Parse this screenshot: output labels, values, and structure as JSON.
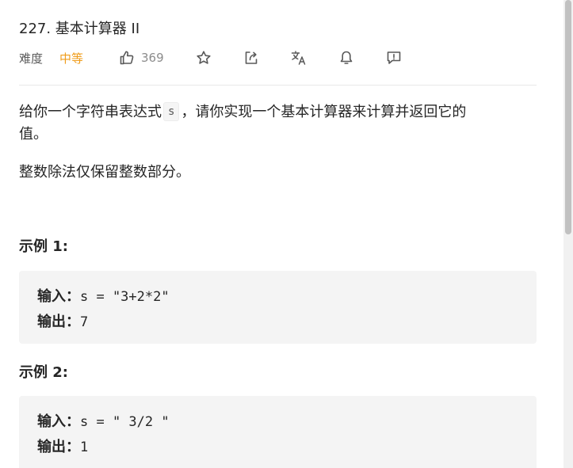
{
  "problem": {
    "title": "227. 基本计算器 II",
    "difficulty_label": "难度",
    "difficulty": "中等",
    "likes": "369"
  },
  "toolbar_icons": [
    "thumbs-up-icon",
    "star-icon",
    "share-icon",
    "translate-icon",
    "bell-icon",
    "feedback-icon"
  ],
  "colors": {
    "difficulty_medium": "#ef9c1b",
    "icon": "#595959",
    "code_bg": "#f4f4f4",
    "divider": "#e8e8e8"
  },
  "description": {
    "part1": "给你一个字符串表达式",
    "code": "s",
    "part2": "，请你实现一个基本计算器来计算并返回它的",
    "part3": "值。",
    "paragraph2": "整数除法仅保留整数部分。"
  },
  "examples": [
    {
      "title": "示例 1:",
      "input_label": "输入：",
      "input_value": "s = \"3+2*2\"",
      "output_label": "输出：",
      "output_value": "7"
    },
    {
      "title": "示例 2:",
      "input_label": "输入：",
      "input_value": "s = \" 3/2 \"",
      "output_label": "输出：",
      "output_value": "1"
    }
  ]
}
